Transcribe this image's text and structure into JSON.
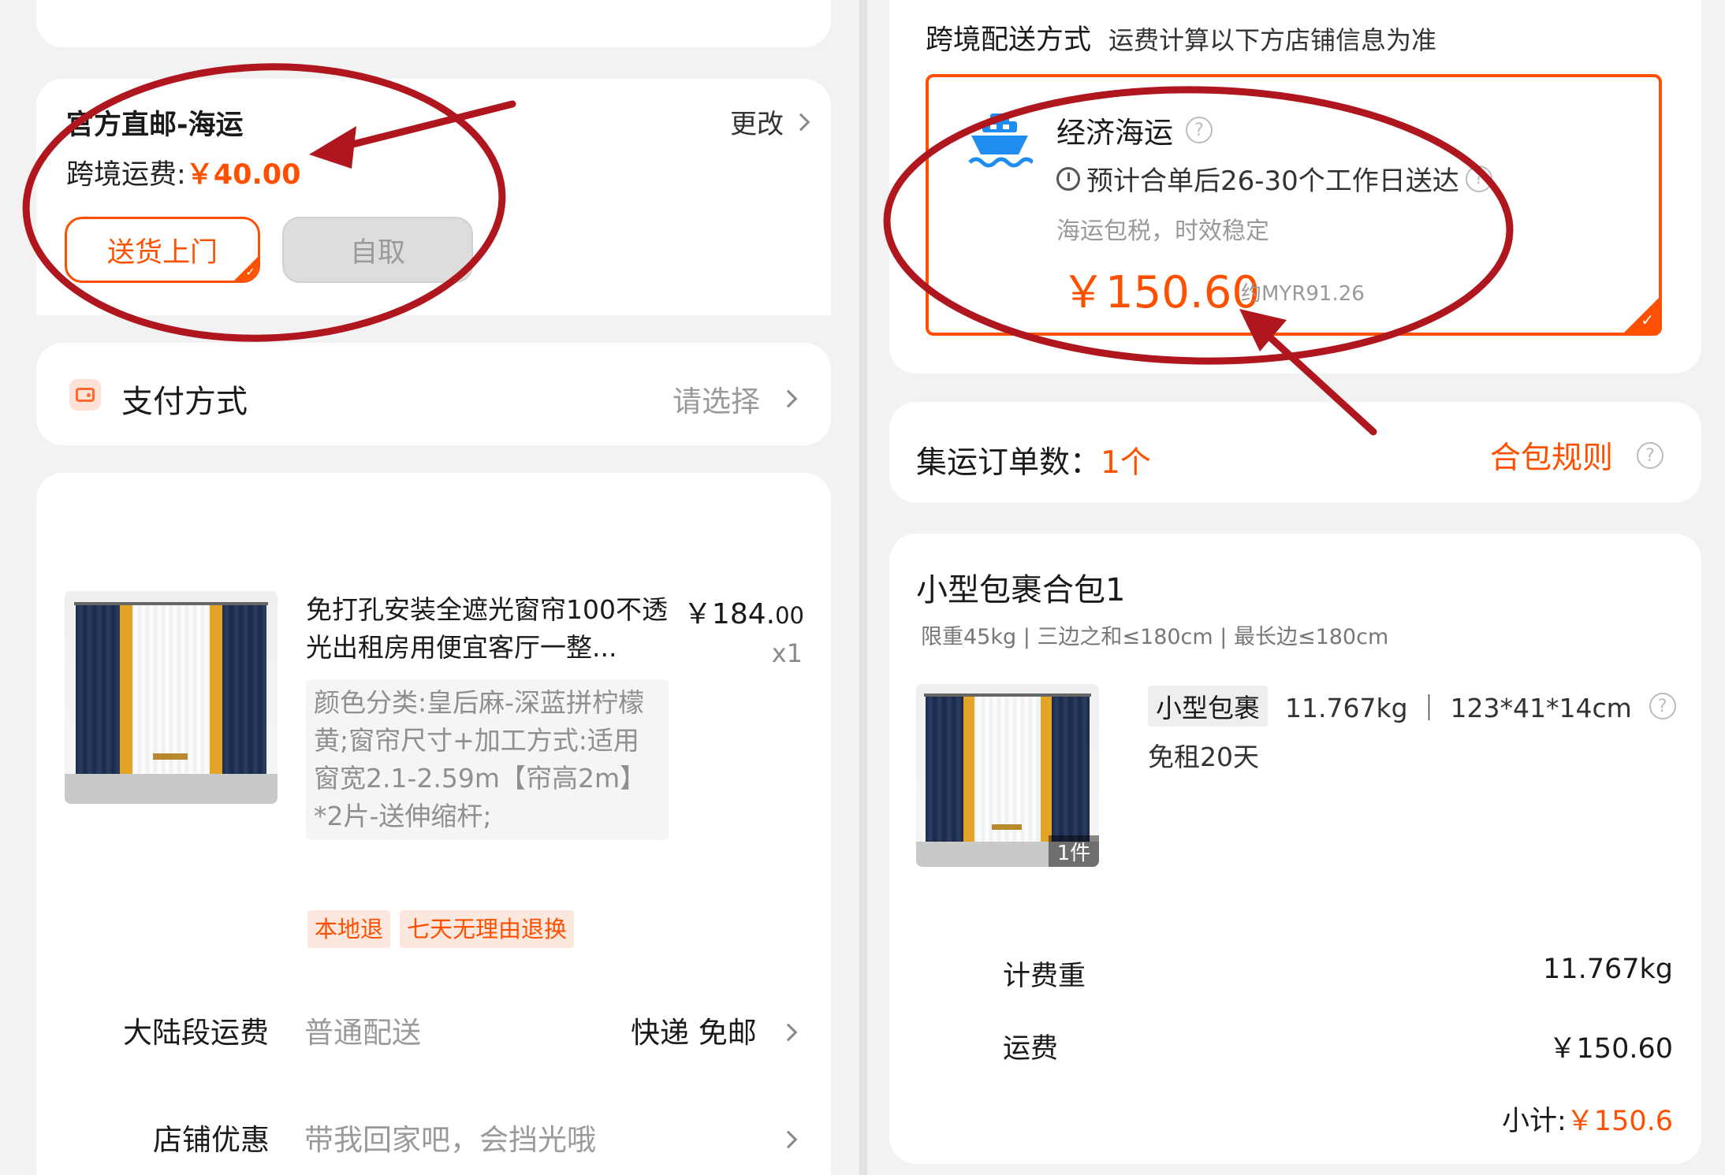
{
  "left": {
    "delivery": {
      "method_title": "官方直邮-海运",
      "change_label": "更改",
      "fee_label": "跨境运费:",
      "fee_amount": "￥40.00",
      "home_delivery_label": "送货上门",
      "pickup_label": "自取"
    },
    "payment": {
      "label": "支付方式",
      "placeholder": "请选择"
    },
    "product": {
      "title": "免打孔安装全遮光窗帘100不透光出租房用便宜客厅一整...",
      "price_main": "￥184.",
      "price_decimal": "00",
      "quantity": "x1",
      "spec": "颜色分类:皇后麻-深蓝拼柠檬黄;窗帘尺寸+加工方式:适用窗宽2.1-2.59m【帘高2m】*2片-送伸缩杆;",
      "tags": [
        "本地退",
        "七天无理由退换"
      ]
    },
    "mainland_shipping": {
      "label": "大陆段运费",
      "value": "普通配送",
      "right": "快递 免邮"
    },
    "store_promo": {
      "label": "店铺优惠",
      "value": "带我回家吧，会挡光哦"
    }
  },
  "right": {
    "shipping": {
      "header": "跨境配送方式",
      "header_note": "运费计算以下方店铺信息为准",
      "option_name": "经济海运",
      "eta": "预计合单后26-30个工作日送达",
      "note": "海运包税，时效稳定",
      "price": "￥150.60",
      "converted": "约MYR91.26",
      "icon": "ship-icon"
    },
    "consolidation": {
      "label": "集运订单数：",
      "count": "1个",
      "rules_link": "合包规则"
    },
    "package": {
      "title": "小型包裹合包1",
      "limits": "限重45kg | 三边之和≤180cm | 最长边≤180cm",
      "type": "小型包裹",
      "dimensions": "11.767kg ｜ 123*41*14cm",
      "free_storage": "免租20天",
      "item_count": "1件",
      "billing_weight_label": "计费重",
      "billing_weight_value": "11.767kg",
      "freight_label": "运费",
      "freight_value": "￥150.60",
      "subtotal_label": "小计:",
      "subtotal_value": "￥150.6"
    }
  },
  "colors": {
    "accent": "#ff5000",
    "annotation": "#b0161e"
  }
}
